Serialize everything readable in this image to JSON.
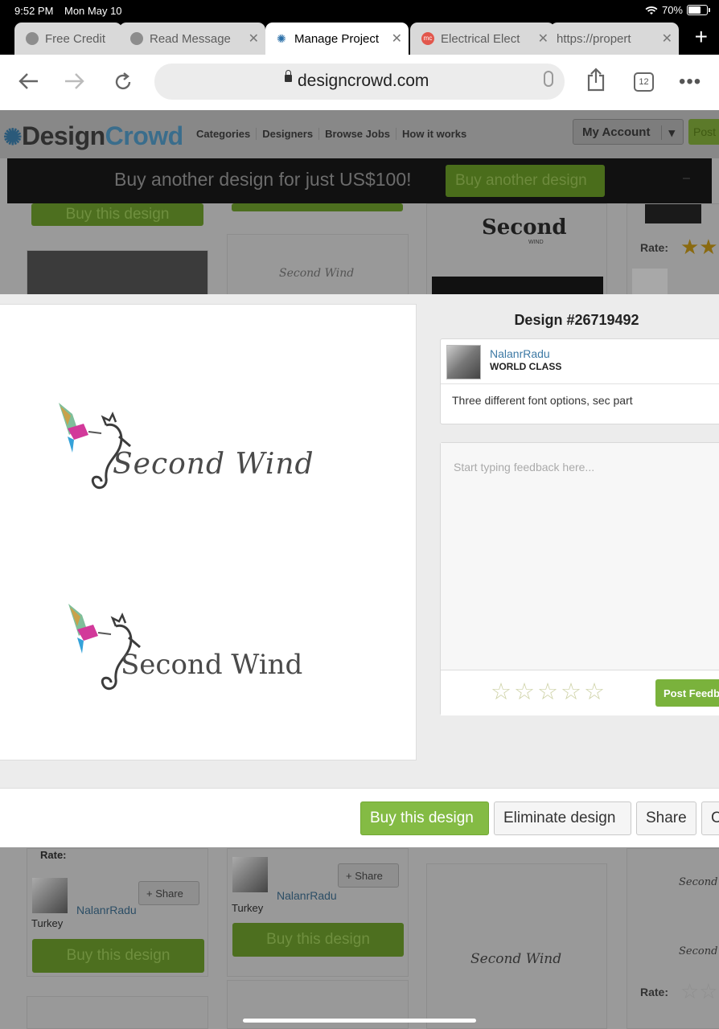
{
  "status": {
    "time": "9:52 PM",
    "date": "Mon May 10",
    "battery": "70%"
  },
  "tabs": [
    {
      "label": "Free Credit",
      "icon": "globe-icon"
    },
    {
      "label": "Read Message",
      "icon": "globe-icon"
    },
    {
      "label": "Manage Project",
      "icon": "designcrowd-icon",
      "active": true
    },
    {
      "label": "Electrical Elect",
      "icon": "mc-icon"
    },
    {
      "label": "https://propert",
      "icon": ""
    }
  ],
  "toolbar": {
    "url": "designcrowd.com",
    "tab_count": "12"
  },
  "site": {
    "logo_a": "Design",
    "logo_b": "Crowd",
    "nav": [
      "Categories",
      "Designers",
      "Browse Jobs",
      "How it works"
    ],
    "my_account": "My Account",
    "post": "Post",
    "promo_text": "Buy another design for just US$100!",
    "promo_button": "Buy another design",
    "rate_label": "Rate:",
    "buy_label": "Buy this design",
    "share_label": "+ Share",
    "designer": "NalanrRadu",
    "country": "Turkey",
    "second": "Second",
    "wind": "WIND",
    "second_wind": "Second Wind"
  },
  "modal": {
    "title": "Design #26719492",
    "designer": {
      "name": "NalanrRadu",
      "level": "WORLD CLASS"
    },
    "description": "Three different font options, sec part",
    "feedback_placeholder": "Start typing feedback here...",
    "post_feedback": "Post Feedback",
    "logo_text": "Second Wind",
    "actions": {
      "buy": "Buy this design",
      "eliminate": "Eliminate design",
      "share": "Share",
      "close": "C"
    }
  },
  "colors": {
    "accent_green": "#84bb44",
    "link_blue": "#3d79a4"
  }
}
